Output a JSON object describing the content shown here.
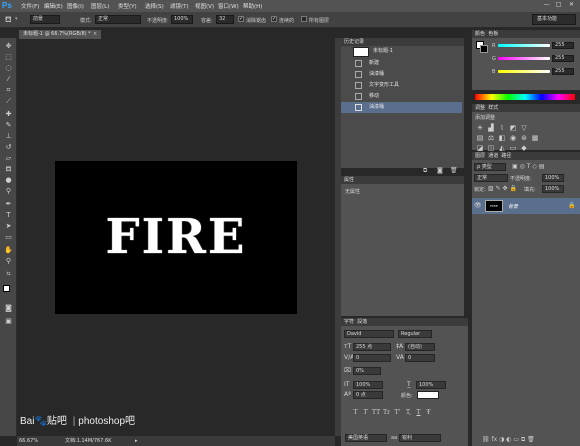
{
  "app": {
    "logo": "Ps"
  },
  "menubar": {
    "items": [
      "文件(F)",
      "编辑(E)",
      "图像(I)",
      "图层(L)",
      "类型(Y)",
      "选择(S)",
      "滤镜(T)",
      "视图(V)",
      "窗口(W)",
      "帮助(H)"
    ],
    "win": {
      "minimize": "—",
      "maximize": "□",
      "close": "✕"
    }
  },
  "options": {
    "preset": "前景",
    "mode_label": "模式:",
    "mode": "正常",
    "opacity_label": "不透明度:",
    "opacity": "100%",
    "tolerance_label": "容差:",
    "tolerance": "32",
    "antialias": "消除锯齿",
    "contiguous": "连续的",
    "all_layers": "所有图层",
    "workspace": "基本功能"
  },
  "document": {
    "tab": "未标题-1 @ 66.7%(RGB/8) *",
    "text": "FIRE",
    "zoom": "66.67%",
    "doc_info": "文档:1.14M/767.6K"
  },
  "history": {
    "tab": "历史记录",
    "snapshot": "未标题-1",
    "items": [
      "新建",
      "油漆桶",
      "文字变形工具",
      "移动",
      "油漆桶"
    ],
    "selected_index": 4
  },
  "color": {
    "tabs": [
      "颜色",
      "色板"
    ],
    "r_label": "R",
    "g_label": "G",
    "b_label": "B",
    "r": "255",
    "g": "255",
    "b": "255",
    "accent": {
      "r": "#e04040",
      "g": "#40c040",
      "b": "#e0c020"
    }
  },
  "adjustments": {
    "tabs": [
      "调整",
      "样式"
    ],
    "title": "添加调整"
  },
  "properties": {
    "tab": "属性",
    "text": "无属性"
  },
  "layers": {
    "tabs": [
      "图层",
      "通道",
      "路径"
    ],
    "kind": "ρ 类型",
    "blend": "正常",
    "opacity_label": "不透明度:",
    "opacity": "100%",
    "lock_label": "锁定:",
    "fill_label": "填充:",
    "fill": "100%",
    "layer": {
      "name": "背景",
      "thumb": "FIRE"
    }
  },
  "character": {
    "tabs": [
      "字符",
      "段落"
    ],
    "font": "David",
    "style": "Regular",
    "size": "255 点",
    "leading": "(自动)",
    "kerning": "0",
    "tracking": "0",
    "vscale": "0%",
    "hscale_v": "100%",
    "hscale_h": "100%",
    "baseline": "0 点",
    "color_label": "颜色:",
    "language": "美国英语",
    "aa": "锐利",
    "styles": [
      "T",
      "T",
      "TT",
      "Tr",
      "T'",
      "T,",
      "T",
      "Ŧ"
    ]
  },
  "watermark": {
    "brand": "Bai",
    "du": "du",
    "tieba": "贴吧",
    "sep": "|",
    "forum": "photoshop吧"
  }
}
